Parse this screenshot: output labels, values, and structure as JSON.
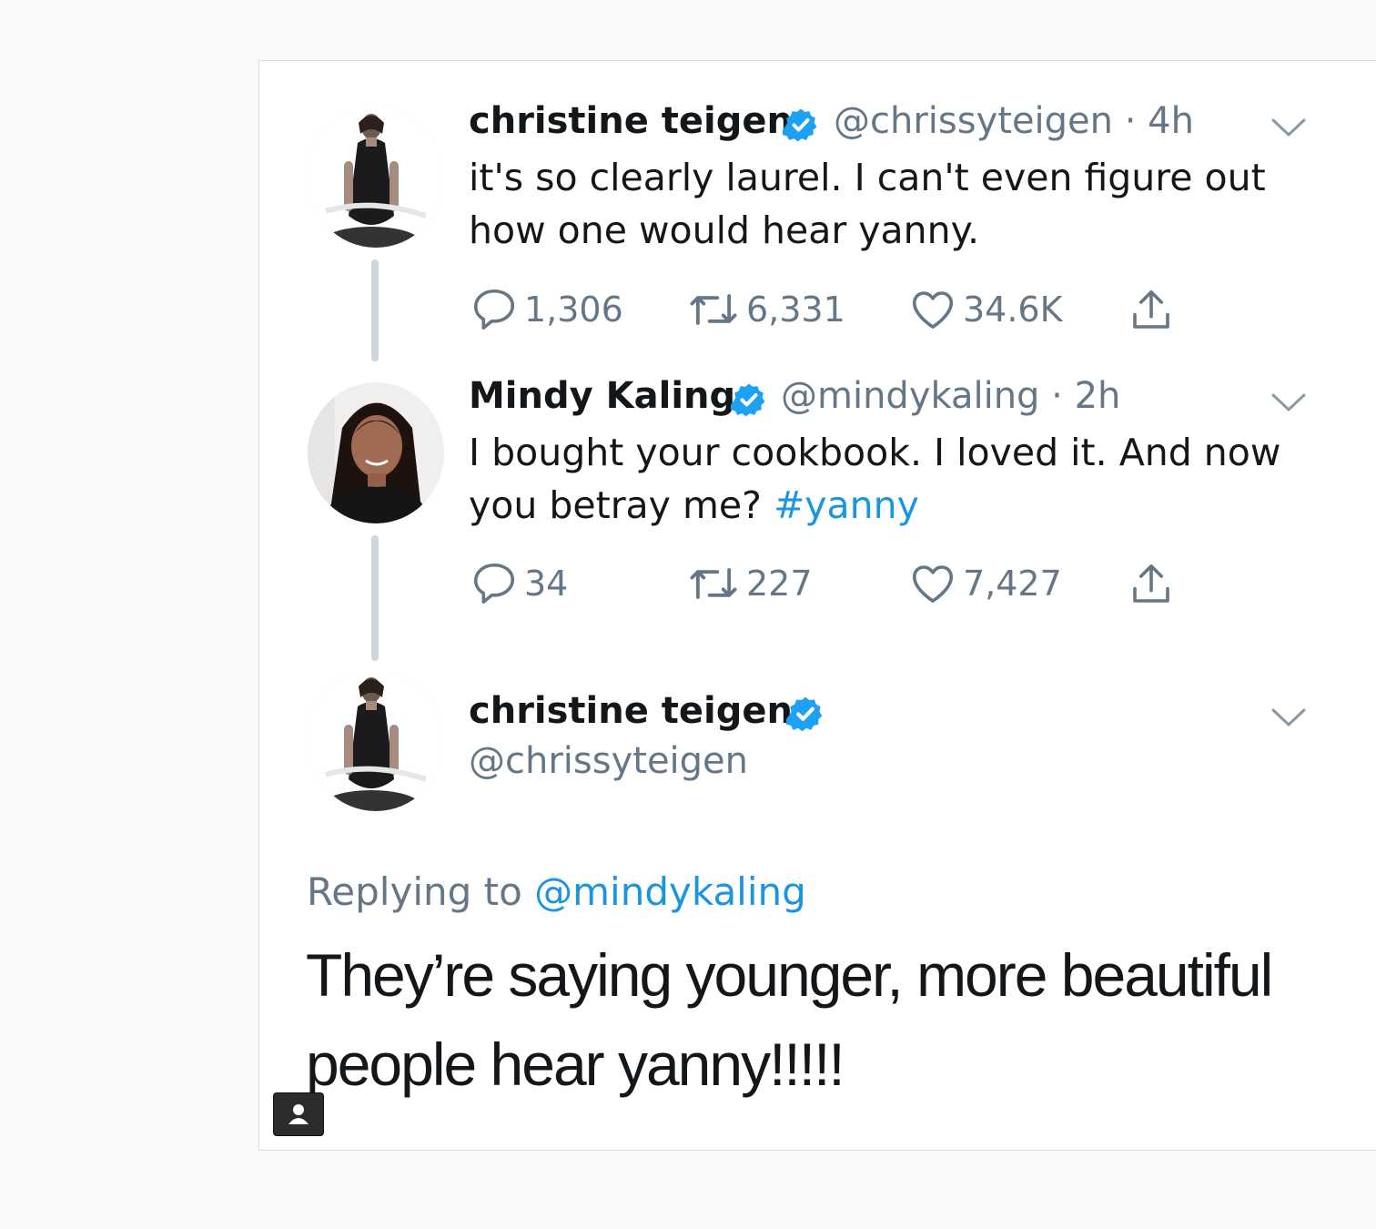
{
  "tweets": [
    {
      "name": "christine teigen",
      "handle": "@chrissyteigen",
      "time": "· 4h",
      "line1": "it's so clearly laurel. I can't even figure out",
      "line2": "how one would hear yanny.",
      "replies": "1,306",
      "retweets": "6,331",
      "likes": "34.6K"
    },
    {
      "name": "Mindy Kaling",
      "handle": "@mindykaling",
      "time": "· 2h",
      "line1": "I bought your cookbook. I loved it. And now",
      "line2_text": "you betray me? ",
      "line2_link": "#yanny",
      "replies": "34",
      "retweets": "227",
      "likes": "7,427"
    }
  ],
  "main_tweet": {
    "name": "christine teigen",
    "handle": "@chrissyteigen",
    "replying_label": "Replying to ",
    "replying_handle": "@mindykaling",
    "line1": "They’re saying younger, more beautiful",
    "line2": "people hear yanny!!!!!"
  },
  "icons": {
    "reply": "reply-icon",
    "retweet": "retweet-icon",
    "like": "heart-icon",
    "share": "share-icon",
    "verified": "verified-badge-icon",
    "caret": "chevron-down-icon",
    "camera": "user-icon"
  },
  "colors": {
    "link": "#1b95e0",
    "verified": "#1da1f2",
    "muted": "#657786",
    "thread_line": "#ccd6dd"
  }
}
